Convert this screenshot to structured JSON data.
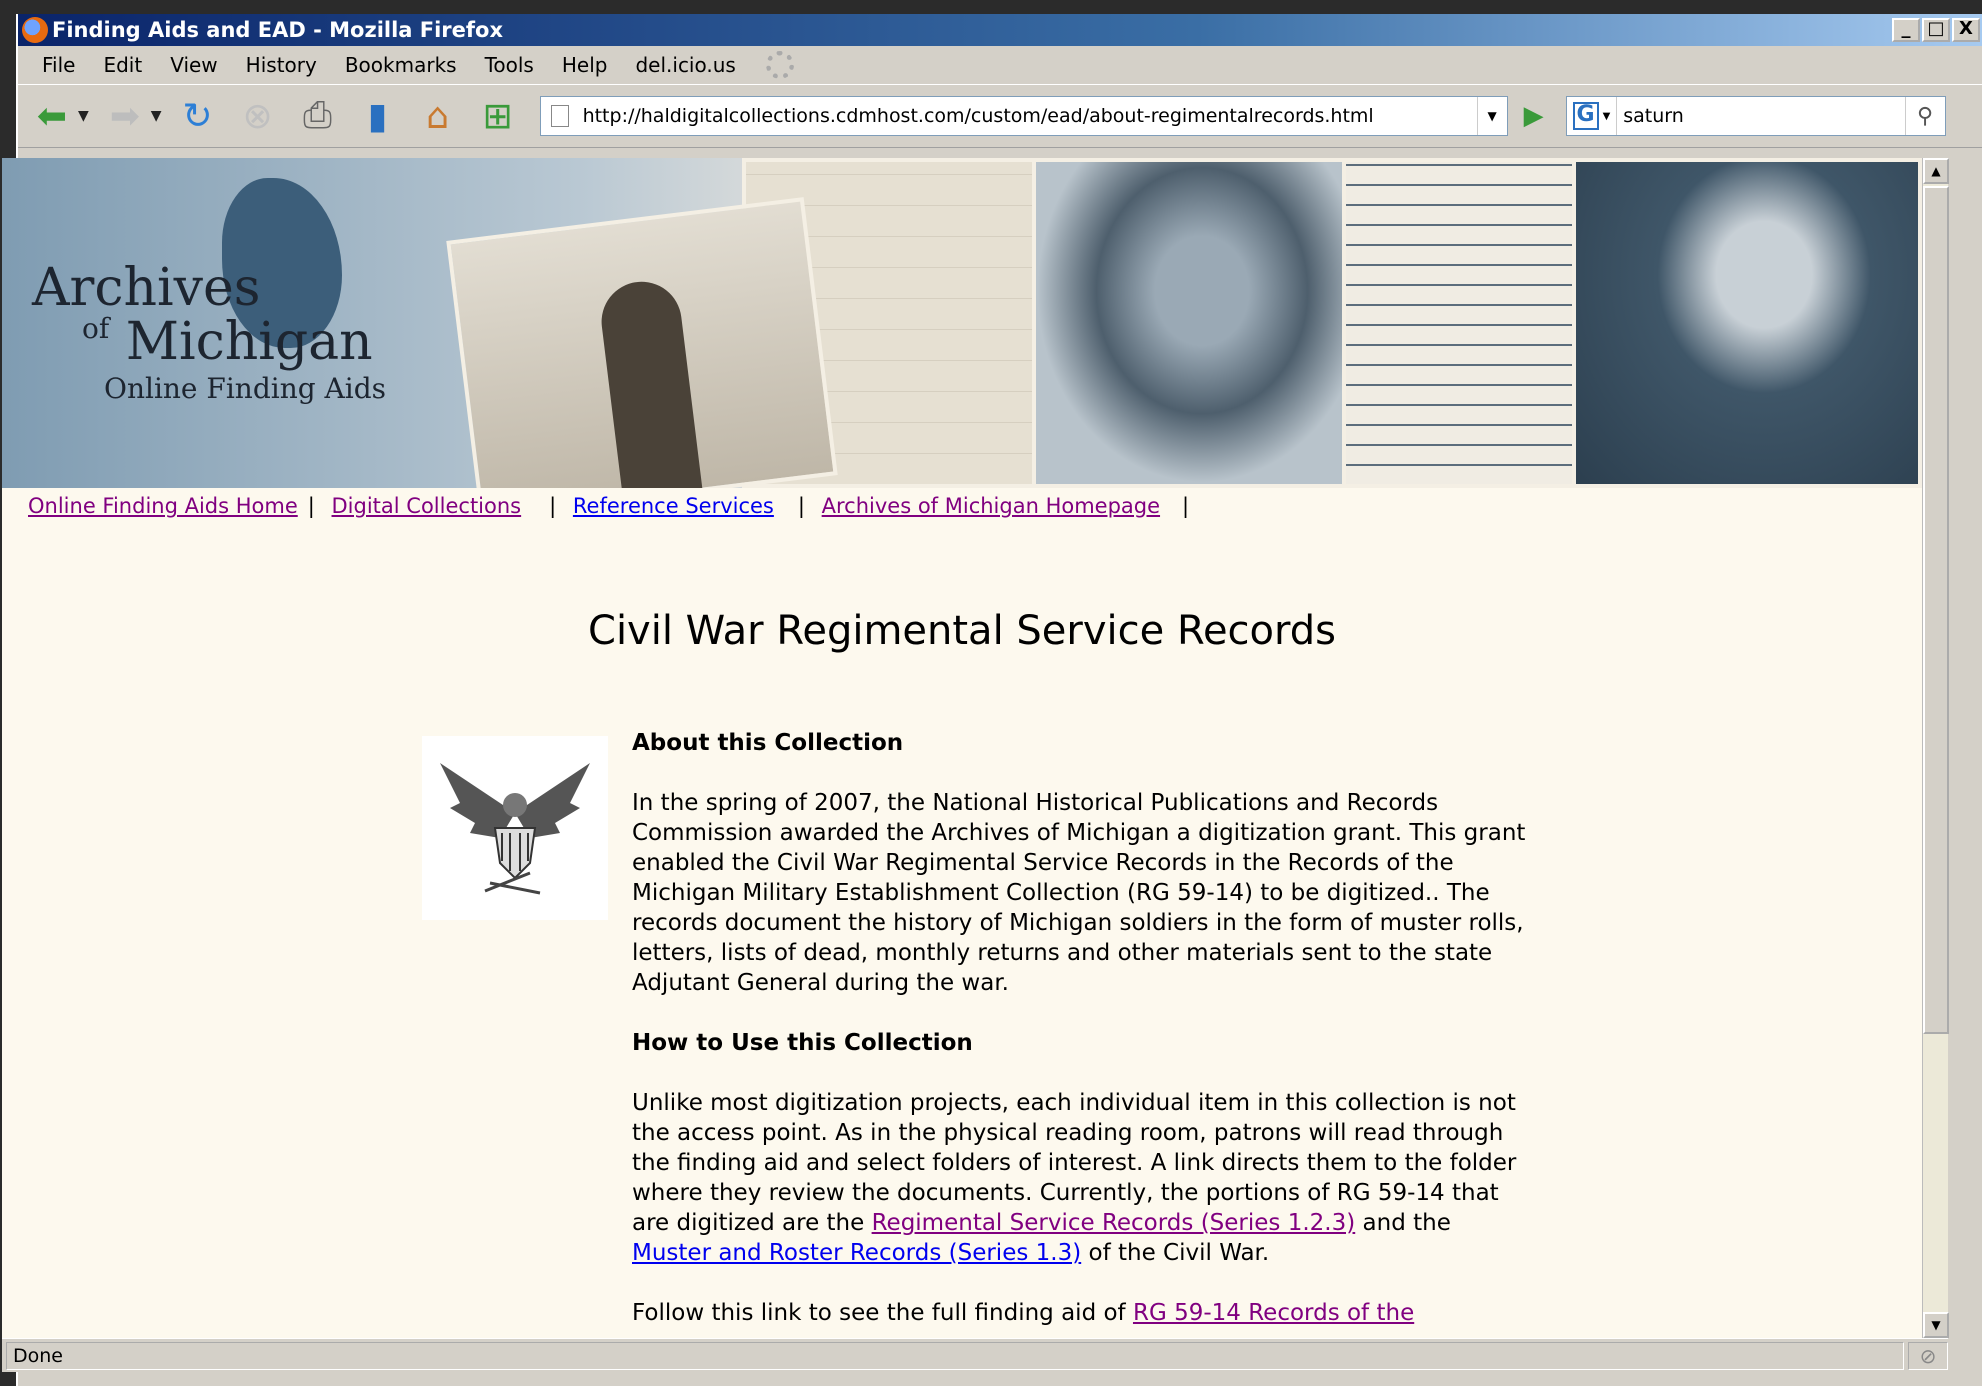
{
  "window": {
    "title": "Finding Aids and EAD - Mozilla Firefox",
    "controls": {
      "minimize": "_",
      "maximize": "□",
      "close": "X"
    }
  },
  "menubar": {
    "items": [
      "File",
      "Edit",
      "View",
      "History",
      "Bookmarks",
      "Tools",
      "Help",
      "del.icio.us"
    ]
  },
  "navbar": {
    "url": "http://haldigitalcollections.cdmhost.com/custom/ead/about-regimentalrecords.html",
    "search_value": "saturn",
    "search_engine": "G"
  },
  "banner": {
    "logo_line1": "Archives",
    "logo_of": "of",
    "logo_line2": "Michigan",
    "logo_line3": "Online Finding Aids"
  },
  "navlinks": [
    {
      "label": "Online Finding Aids Home",
      "visited": true
    },
    {
      "label": "Digital Collections",
      "visited": true
    },
    {
      "label": "Reference Services",
      "visited": false
    },
    {
      "label": "Archives of Michigan Homepage",
      "visited": true
    }
  ],
  "navsep": "|",
  "page": {
    "title": "Civil War Regimental Service Records",
    "about_heading": "About this Collection",
    "about_text": "In the spring of 2007, the National Historical Publications and Records Commission awarded the Archives of Michigan a digitization grant. This grant enabled the Civil War Regimental Service Records in the Records of the Michigan Military Establishment Collection (RG 59-14) to be digitized.. The records document the history of Michigan soldiers in the form of muster rolls, letters, lists of dead, monthly returns and other materials sent to the state Adjutant General during the war.",
    "howto_heading": "How to Use this Collection",
    "howto_text_before": "Unlike most digitization projects, each individual item in this collection is not the access point. As in the physical reading room, patrons will read through the finding aid and select folders of interest. A link directs them to the folder where they review the documents. Currently, the portions of RG 59-14 that are digitized are the ",
    "howto_link1": "Regimental Service Records (Series 1.2.3)",
    "howto_mid": " and the ",
    "howto_link2": "Muster and Roster Records (Series 1.3)",
    "howto_after": " of the Civil War.",
    "follow_text": "Follow this link to see the full finding aid of ",
    "follow_link": "RG 59-14 Records of the"
  },
  "statusbar": {
    "text": "Done"
  }
}
